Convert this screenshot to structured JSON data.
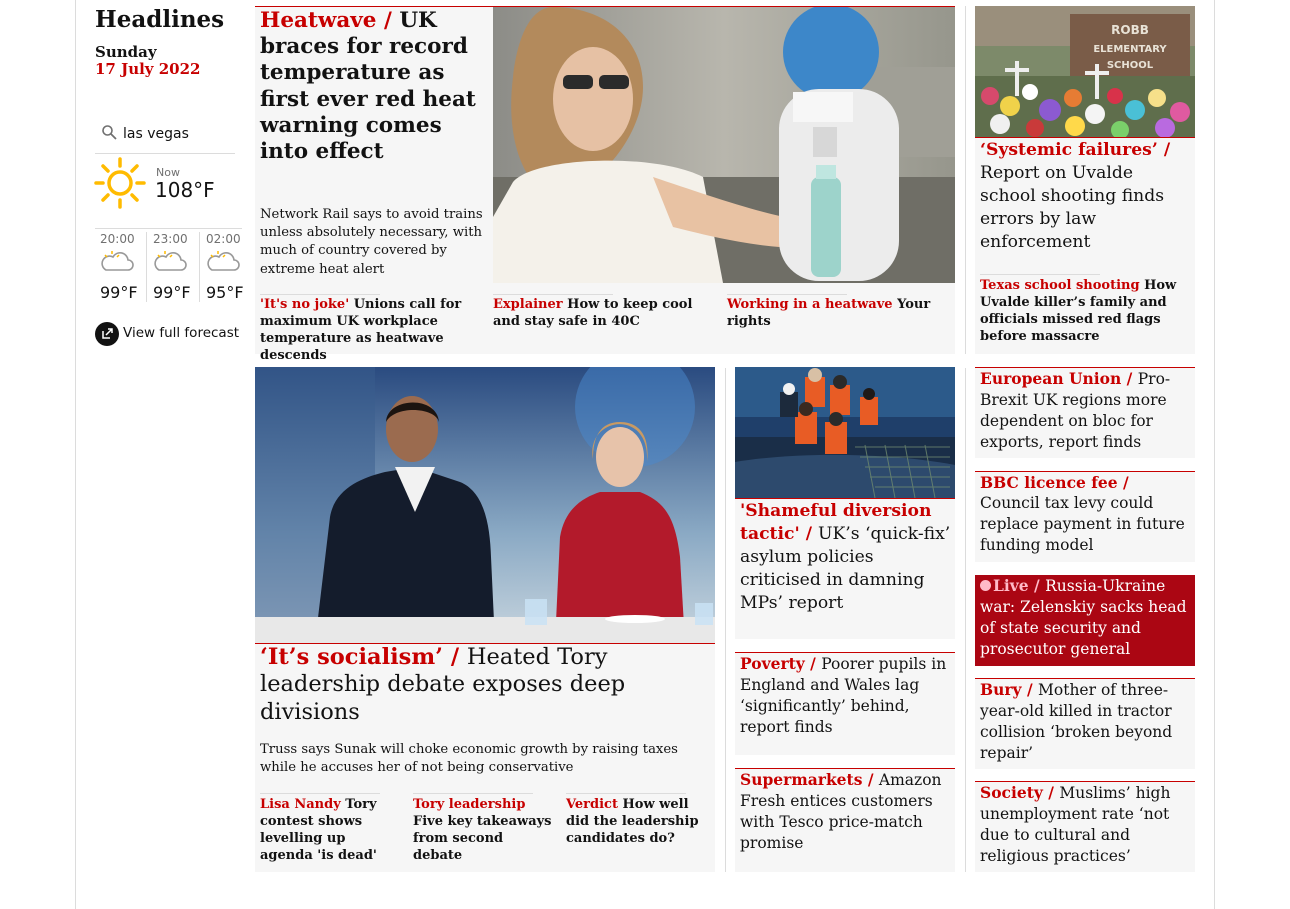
{
  "sidebar": {
    "title": "Headlines",
    "day": "Sunday",
    "date": "17 July 2022",
    "search_value": "las vegas",
    "now_label": "Now",
    "now_temp": "108°F",
    "forecast": [
      {
        "time": "20:00",
        "temp": "99°F"
      },
      {
        "time": "23:00",
        "temp": "99°F"
      },
      {
        "time": "02:00",
        "temp": "95°F"
      }
    ],
    "full_forecast": "View full forecast"
  },
  "lead": {
    "kicker": "Heatwave /",
    "headline": "UK braces for record temperature as first ever red heat warning comes into effect",
    "standfirst": "Network Rail says to avoid trains unless absolutely necessary, with much of country covered by extreme heat alert",
    "sublinks": [
      {
        "kicker": "'It's no joke'",
        "text": "Unions call for maximum UK workplace temperature as heatwave descends"
      },
      {
        "kicker": "Explainer",
        "text": "How to keep cool and stay safe in 40C"
      },
      {
        "kicker": "Working in a heatwave",
        "text": "Your rights"
      }
    ]
  },
  "uvalde": {
    "kicker": "‘Systemic failures’ /",
    "headline": "Report on Uvalde school shooting finds errors by law enforcement",
    "sublink_kicker": "Texas school shooting",
    "sublink_text": "How Uvalde killer’s family and officials missed red flags before massacre",
    "photo_sign": "ROBB ELEMENTARY SCHOOL"
  },
  "tory": {
    "kicker": "‘It’s socialism’ /",
    "headline": "Heated Tory leadership debate exposes deep divisions",
    "standfirst": "Truss says Sunak will choke economic growth by raising taxes while he accuses her of not being conservative",
    "sublinks": [
      {
        "kicker": "Lisa Nandy",
        "text": "Tory contest shows levelling up agenda 'is dead'"
      },
      {
        "kicker": "Tory leadership",
        "text": "Five key takeaways from second debate"
      },
      {
        "kicker": "Verdict",
        "text": "How well did the leadership candidates do?"
      }
    ]
  },
  "asylum": {
    "kicker": "'Shameful diversion tactic' /",
    "headline": "UK’s ‘quick-fix’ asylum policies criticised in damning MPs’ report"
  },
  "poverty": {
    "kicker": "Poverty /",
    "headline": "Poorer pupils in England and Wales lag ‘significantly’ behind, report finds"
  },
  "supermarkets": {
    "kicker": "Supermarkets /",
    "headline": "Amazon Fresh entices customers with Tesco price-match promise"
  },
  "right_column": [
    {
      "kicker": "European Union /",
      "headline": "Pro-Brexit UK regions more dependent on bloc for exports, report finds"
    },
    {
      "kicker": "BBC licence fee /",
      "headline": "Council tax levy could replace payment in future funding model"
    },
    {
      "kicker": "Live /",
      "headline": "Russia-Ukraine war: Zelenskiy sacks head of state security and prosecutor general",
      "live": true
    },
    {
      "kicker": "Bury /",
      "headline": "Mother of three-year-old killed in tractor collision ‘broken beyond repair’"
    },
    {
      "kicker": "Society /",
      "headline": "Muslims’ high unemployment rate ‘not due to cultural and religious practices’"
    }
  ],
  "colors": {
    "news_red": "#c70000",
    "card_bg": "#f6f6f6",
    "rule": "#dcdcdc",
    "text": "#121212"
  }
}
